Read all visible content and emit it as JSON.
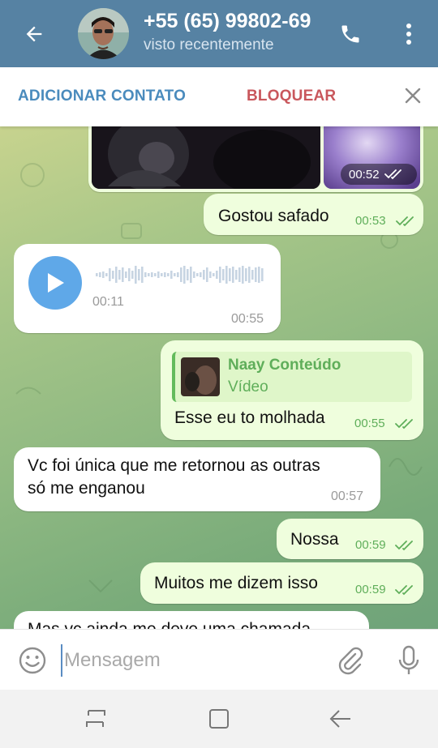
{
  "header": {
    "title": "+55 (65) 99802-69",
    "subtitle": "visto recentemente"
  },
  "action_bar": {
    "add_contact": "ADICIONAR CONTATO",
    "block": "BLOQUEAR"
  },
  "messages": [
    {
      "type": "video",
      "direction": "out",
      "time": "00:52",
      "status": "read"
    },
    {
      "type": "text",
      "direction": "out",
      "text": "Gostou safado",
      "time": "00:53",
      "status": "read"
    },
    {
      "type": "voice",
      "direction": "in",
      "duration": "00:11",
      "time": "00:55"
    },
    {
      "type": "reply",
      "direction": "out",
      "reply_name": "Naay Conteúdo",
      "reply_kind": "Vídeo",
      "text": "Esse eu to molhada",
      "time": "00:55",
      "status": "read"
    },
    {
      "type": "text",
      "direction": "in",
      "lines": [
        "Vc foi única que me retornou as outras",
        "só me enganou"
      ],
      "time": "00:57"
    },
    {
      "type": "text",
      "direction": "out",
      "text": "Nossa",
      "time": "00:59",
      "status": "read"
    },
    {
      "type": "text",
      "direction": "out",
      "text": "Muitos me dizem isso",
      "time": "00:59",
      "status": "read"
    },
    {
      "type": "text",
      "direction": "in",
      "text": "Mas vc ainda me deve uma chamada"
    }
  ],
  "composer": {
    "placeholder": "Mensagem"
  },
  "colors": {
    "header": "#5682a3",
    "outgoing_bubble": "#effedd",
    "incoming_bubble": "#ffffff",
    "accent_green": "#5fae5a",
    "block_red": "#c9575c",
    "link_blue": "#4a8bbd",
    "voice_play": "#5fa8e8"
  },
  "icons": {
    "back": "arrow-left-icon",
    "call": "phone-icon",
    "menu": "more-vertical-icon",
    "close": "close-icon",
    "play": "play-icon",
    "emoji": "smiley-icon",
    "attach": "paperclip-icon",
    "mic": "microphone-icon",
    "nav_recent": "recent-apps-icon",
    "nav_home": "home-icon",
    "nav_back": "nav-back-icon"
  }
}
